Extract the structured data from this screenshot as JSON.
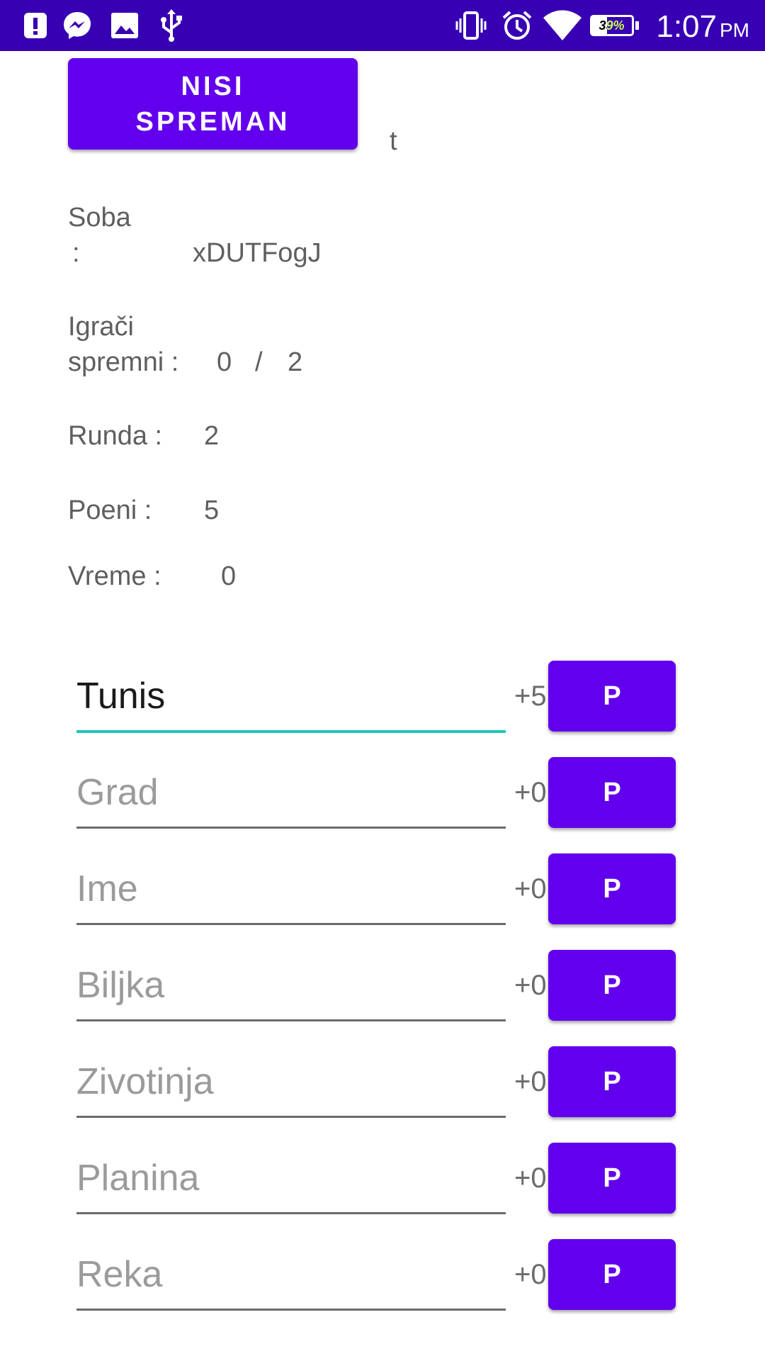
{
  "status_bar": {
    "time": "1:07",
    "ampm": "PM",
    "battery": "39%",
    "icons": [
      "alert-icon",
      "messenger-icon",
      "gallery-icon",
      "usb-icon",
      "vibrate-icon",
      "alarm-icon",
      "wifi-icon",
      "battery-icon"
    ]
  },
  "ready_button": {
    "line1": "NISI",
    "line2": "SPREMAN"
  },
  "stray_text": "t",
  "room": {
    "label_line1": "Soba",
    "label_line2": ":",
    "value": "xDUTFogJ"
  },
  "players_ready": {
    "label_line1": "Igrači",
    "label_line2": "spremni :",
    "ready": "0",
    "separator": "/",
    "total": "2"
  },
  "round": {
    "label": "Runda :",
    "value": "2"
  },
  "points": {
    "label": "Poeni :",
    "value": "5"
  },
  "time": {
    "label": "Vreme :",
    "value": "0"
  },
  "fields": [
    {
      "value": "Tunis",
      "placeholder": "",
      "points": "+5",
      "button": "P"
    },
    {
      "value": "",
      "placeholder": "Grad",
      "points": "+0",
      "button": "P"
    },
    {
      "value": "",
      "placeholder": "Ime",
      "points": "+0",
      "button": "P"
    },
    {
      "value": "",
      "placeholder": "Biljka",
      "points": "+0",
      "button": "P"
    },
    {
      "value": "",
      "placeholder": "Zivotinja",
      "points": "+0",
      "button": "P"
    },
    {
      "value": "",
      "placeholder": "Planina",
      "points": "+0",
      "button": "P"
    },
    {
      "value": "",
      "placeholder": "Reka",
      "points": "+0",
      "button": "P"
    }
  ],
  "colors": {
    "status_bar": "#3700b3",
    "primary": "#6200ee",
    "accent": "#1ec6bc"
  }
}
